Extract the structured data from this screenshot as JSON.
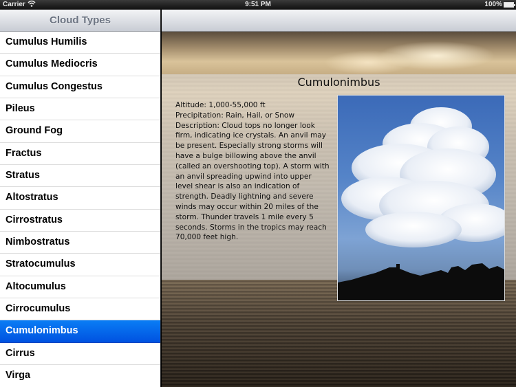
{
  "status_bar": {
    "carrier": "Carrier",
    "time": "9:51 PM",
    "battery": "100%"
  },
  "sidebar": {
    "title": "Cloud Types",
    "items": [
      {
        "label": "Cumulus Humilis"
      },
      {
        "label": "Cumulus Mediocris"
      },
      {
        "label": "Cumulus Congestus"
      },
      {
        "label": "Pileus"
      },
      {
        "label": "Ground Fog"
      },
      {
        "label": "Fractus"
      },
      {
        "label": "Stratus"
      },
      {
        "label": "Altostratus"
      },
      {
        "label": "Cirrostratus"
      },
      {
        "label": "Nimbostratus"
      },
      {
        "label": "Stratocumulus"
      },
      {
        "label": "Altocumulus"
      },
      {
        "label": "Cirrocumulus"
      },
      {
        "label": "Cumulonimbus",
        "selected": true
      },
      {
        "label": "Cirrus"
      },
      {
        "label": "Virga"
      }
    ]
  },
  "detail": {
    "title": "Cumulonimbus",
    "altitude": "Altitude: 1,000-55,000 ft",
    "precipitation": "Precipitation: Rain, Hail, or Snow",
    "description": "Description: Cloud tops no longer look firm, indicating ice crystals.  An anvil may be present.  Especially strong storms will have a bulge billowing above the anvil (called an overshooting top).  A storm with an anvil spreading upwind into upper level shear is also an indication of strength. Deadly lightning and severe winds may occur within 20 miles of the storm.  Thunder travels 1 mile every 5 seconds. Storms in the tropics may reach 70,000 feet high.",
    "photo_colors": {
      "sky": "#4a78c0",
      "cloud": "#f4f7fb",
      "silhouette": "#0c0c0c"
    }
  }
}
